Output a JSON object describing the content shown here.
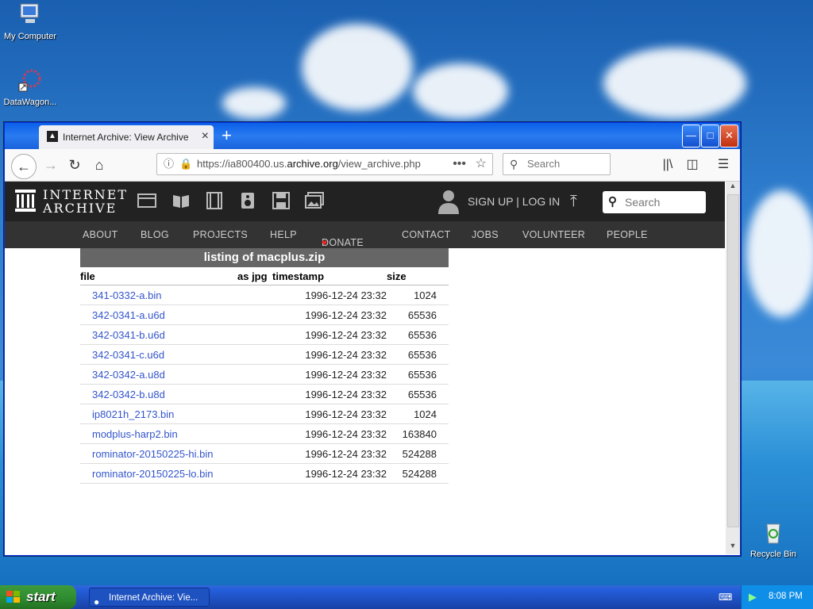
{
  "desktop": {
    "icons": [
      {
        "label": "My Computer"
      },
      {
        "label": "DataWagon..."
      },
      {
        "label": "Recycle Bin"
      }
    ]
  },
  "browser": {
    "tab_title": "Internet Archive: View Archive",
    "url_prefix": "https://ia800400.us.",
    "url_domain": "archive.org",
    "url_suffix": "/view_archive.php",
    "search_placeholder": "Search"
  },
  "ia": {
    "logo_line1": "INTERNET",
    "logo_line2": "ARCHIVE",
    "signup": "SIGN UP | LOG IN",
    "search_placeholder": "Search",
    "menu": [
      "ABOUT",
      "BLOG",
      "PROJECTS",
      "HELP",
      "DONATE",
      "CONTACT",
      "JOBS",
      "VOLUNTEER",
      "PEOPLE"
    ],
    "listing_title": "listing of macplus.zip",
    "columns": {
      "file": "file",
      "as_jpg": "as jpg",
      "timestamp": "timestamp",
      "size": "size"
    },
    "rows": [
      {
        "file": "341-0332-a.bin",
        "timestamp": "1996-12-24 23:32",
        "size": "1024"
      },
      {
        "file": "342-0341-a.u6d",
        "timestamp": "1996-12-24 23:32",
        "size": "65536"
      },
      {
        "file": "342-0341-b.u6d",
        "timestamp": "1996-12-24 23:32",
        "size": "65536"
      },
      {
        "file": "342-0341-c.u6d",
        "timestamp": "1996-12-24 23:32",
        "size": "65536"
      },
      {
        "file": "342-0342-a.u8d",
        "timestamp": "1996-12-24 23:32",
        "size": "65536"
      },
      {
        "file": "342-0342-b.u8d",
        "timestamp": "1996-12-24 23:32",
        "size": "65536"
      },
      {
        "file": "ip8021h_2173.bin",
        "timestamp": "1996-12-24 23:32",
        "size": "1024"
      },
      {
        "file": "modplus-harp2.bin",
        "timestamp": "1996-12-24 23:32",
        "size": "163840"
      },
      {
        "file": "rominator-20150225-hi.bin",
        "timestamp": "1996-12-24 23:32",
        "size": "524288"
      },
      {
        "file": "rominator-20150225-lo.bin",
        "timestamp": "1996-12-24 23:32",
        "size": "524288"
      }
    ]
  },
  "taskbar": {
    "start_label": "start",
    "task_label": "Internet Archive: Vie...",
    "clock": "8:08 PM"
  }
}
